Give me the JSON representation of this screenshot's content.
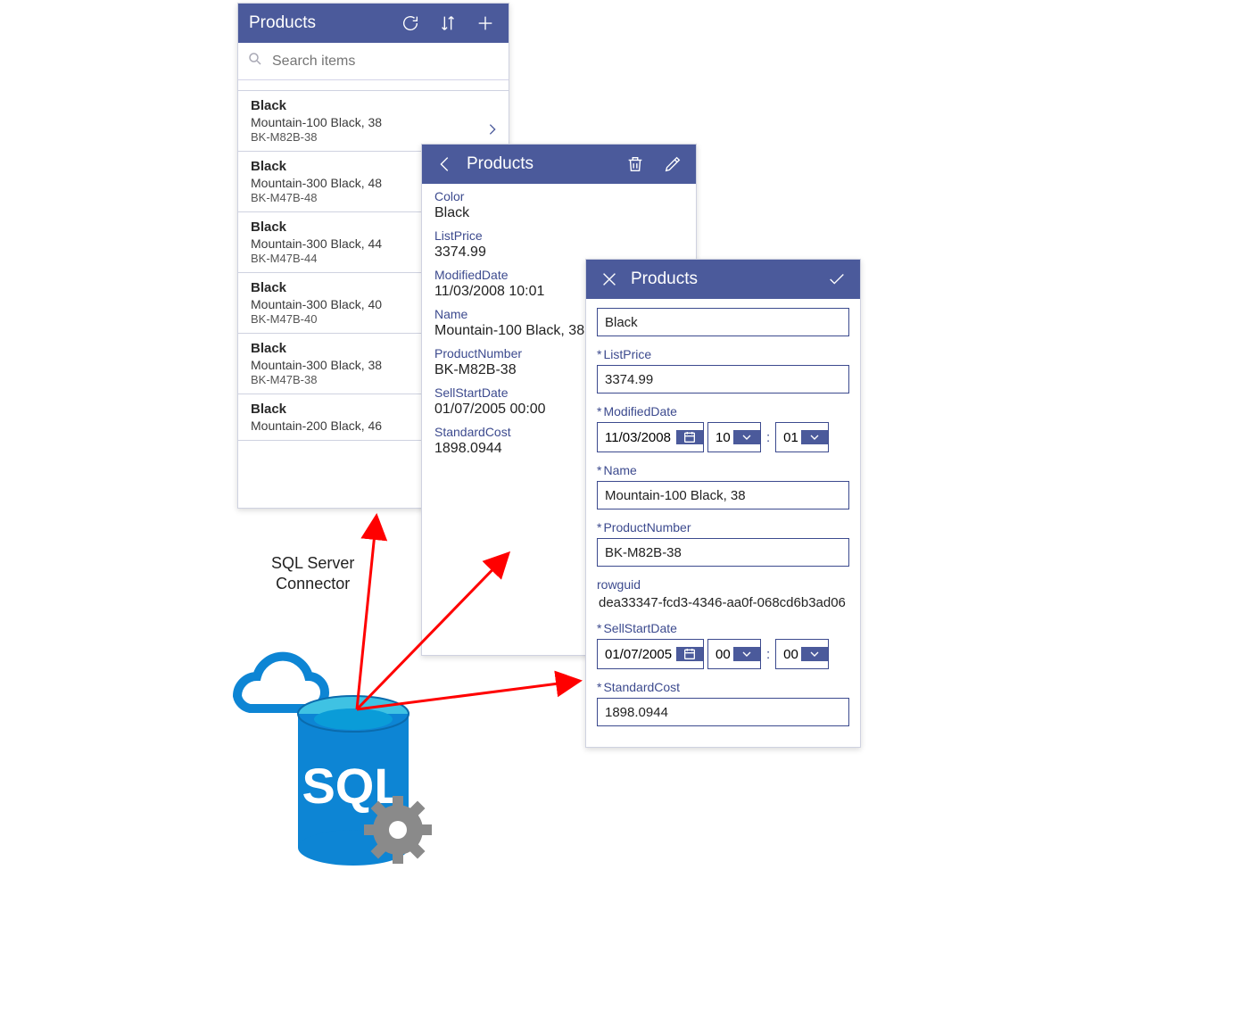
{
  "panelA": {
    "title": "Products",
    "searchPlaceholder": "Search items",
    "items": [
      {
        "color": "Black",
        "name": "Mountain-100 Black, 38",
        "sku": "BK-M82B-38",
        "selected": true
      },
      {
        "color": "Black",
        "name": "Mountain-300 Black, 48",
        "sku": "BK-M47B-48"
      },
      {
        "color": "Black",
        "name": "Mountain-300 Black, 44",
        "sku": "BK-M47B-44"
      },
      {
        "color": "Black",
        "name": "Mountain-300 Black, 40",
        "sku": "BK-M47B-40"
      },
      {
        "color": "Black",
        "name": "Mountain-300 Black, 38",
        "sku": "BK-M47B-38"
      },
      {
        "color": "Black",
        "name": "Mountain-200 Black, 46",
        "sku": ""
      }
    ]
  },
  "panelB": {
    "title": "Products",
    "fields": {
      "Color": "Black",
      "ListPrice": "3374.99",
      "ModifiedDate": "11/03/2008 10:01",
      "Name": "Mountain-100 Black, 38",
      "ProductNumber": "BK-M82B-38",
      "SellStartDate": "01/07/2005 00:00",
      "StandardCost": "1898.0944"
    },
    "labels": {
      "Color": "Color",
      "ListPrice": "ListPrice",
      "ModifiedDate": "ModifiedDate",
      "Name": "Name",
      "ProductNumber": "ProductNumber",
      "SellStartDate": "SellStartDate",
      "StandardCost": "StandardCost"
    }
  },
  "panelC": {
    "title": "Products",
    "colorValue": "Black",
    "labels": {
      "ListPrice": "ListPrice",
      "ModifiedDate": "ModifiedDate",
      "Name": "Name",
      "ProductNumber": "ProductNumber",
      "rowguid": "rowguid",
      "SellStartDate": "SellStartDate",
      "StandardCost": "StandardCost"
    },
    "required": {
      "ListPrice": true,
      "ModifiedDate": true,
      "Name": true,
      "ProductNumber": true,
      "rowguid": false,
      "SellStartDate": true,
      "StandardCost": true
    },
    "values": {
      "ListPrice": "3374.99",
      "ModifiedDate": {
        "date": "11/03/2008",
        "hh": "10",
        "mm": "01"
      },
      "Name": "Mountain-100 Black, 38",
      "ProductNumber": "BK-M82B-38",
      "rowguid": "dea33347-fcd3-4346-aa0f-068cd6b3ad06",
      "SellStartDate": {
        "date": "01/07/2005",
        "hh": "00",
        "mm": "00"
      },
      "StandardCost": "1898.0944"
    }
  },
  "annotation": {
    "line1": "SQL Server",
    "line2": "Connector"
  },
  "sqlLabel": "SQL",
  "colors": {
    "accent": "#4b5a9b",
    "azure": "#0d85d4",
    "cyan": "#3fc2e3",
    "arrow": "#ff0000"
  }
}
